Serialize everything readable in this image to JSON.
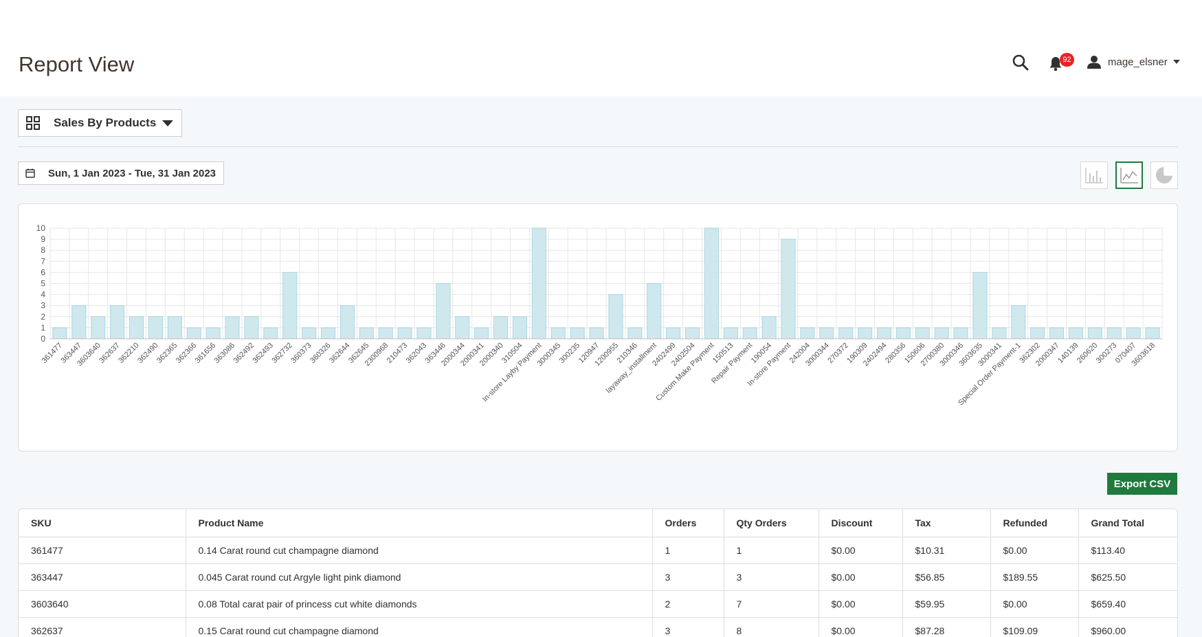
{
  "header": {
    "title": "Report View",
    "notification_count": "92",
    "username": "mage_elsner"
  },
  "report_selector": {
    "label": "Sales By Products"
  },
  "date_range": {
    "label": "Sun, 1 Jan 2023 - Tue, 31 Jan 2023"
  },
  "chart_buttons": [
    "bar-chart",
    "line-chart",
    "pie-chart"
  ],
  "chart_data": {
    "type": "bar",
    "title": "",
    "xlabel": "",
    "ylabel": "",
    "ylim": [
      0,
      10
    ],
    "yticks": [
      0,
      1,
      2,
      3,
      4,
      5,
      6,
      7,
      8,
      9,
      10
    ],
    "grid": true,
    "color": "#cfe8ee",
    "categories": [
      "361477",
      "363447",
      "3603640",
      "362637",
      "362210",
      "362490",
      "362365",
      "362366",
      "361656",
      "363086",
      "362492",
      "362493",
      "362732",
      "360373",
      "360326",
      "362644",
      "362645",
      "2300968",
      "210473",
      "362043",
      "363446",
      "2000344",
      "2000341",
      "2000340",
      "310504",
      "In-store Layby Payment",
      "3000345",
      "300235",
      "120947",
      "1200955",
      "210346",
      "layaway_installment",
      "2402499",
      "2402504",
      "Custom Make Payment",
      "150513",
      "Repair Payment",
      "190054",
      "In-store Payment",
      "242004",
      "3000344",
      "270372",
      "190309",
      "2402494",
      "280356",
      "150606",
      "2700380",
      "3000346",
      "3603635",
      "3000341",
      "Special Order Payment-1",
      "362302",
      "2000347",
      "140139",
      "260620",
      "300273",
      "070407",
      "3603618"
    ],
    "values": [
      1,
      3,
      2,
      3,
      2,
      2,
      2,
      1,
      1,
      2,
      2,
      1,
      6,
      1,
      1,
      3,
      1,
      1,
      1,
      1,
      5,
      2,
      1,
      2,
      2,
      10,
      1,
      1,
      1,
      4,
      1,
      5,
      1,
      1,
      10,
      1,
      1,
      2,
      9,
      1,
      1,
      1,
      1,
      1,
      1,
      1,
      1,
      1,
      6,
      1,
      3,
      1,
      1,
      1,
      1,
      1,
      1,
      1
    ]
  },
  "export_label": "Export CSV",
  "table": {
    "columns": [
      "SKU",
      "Product Name",
      "Orders",
      "Qty Orders",
      "Discount",
      "Tax",
      "Refunded",
      "Grand Total"
    ],
    "rows": [
      [
        "361477",
        "0.14 Carat round cut champagne diamond",
        "1",
        "1",
        "$0.00",
        "$10.31",
        "$0.00",
        "$113.40"
      ],
      [
        "363447",
        "0.045 Carat round cut Argyle light pink diamond",
        "3",
        "3",
        "$0.00",
        "$56.85",
        "$189.55",
        "$625.50"
      ],
      [
        "3603640",
        "0.08 Total carat pair of princess cut white diamonds",
        "2",
        "7",
        "$0.00",
        "$59.95",
        "$0.00",
        "$659.40"
      ],
      [
        "362637",
        "0.15 Carat round cut champagne diamond",
        "3",
        "8",
        "$0.00",
        "$87.28",
        "$109.09",
        "$960.00"
      ]
    ]
  }
}
